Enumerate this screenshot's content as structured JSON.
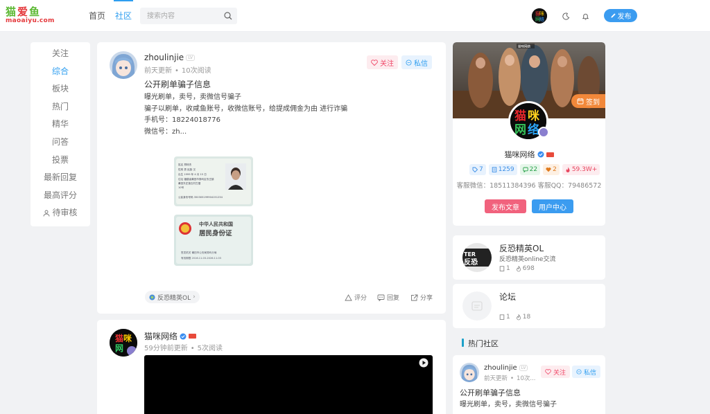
{
  "header": {
    "logo_cn": [
      "猫",
      "爱",
      "鱼"
    ],
    "logo_en": "maoaiyu.com",
    "nav": [
      {
        "label": "首页"
      },
      {
        "label": "社区"
      }
    ],
    "search_placeholder": "搜索内容",
    "publish_label": "发布"
  },
  "sidebar": {
    "items": [
      {
        "label": "关注"
      },
      {
        "label": "综合"
      },
      {
        "label": "板块"
      },
      {
        "label": "热门"
      },
      {
        "label": "精华"
      },
      {
        "label": "问答"
      },
      {
        "label": "投票"
      },
      {
        "label": "最新回复"
      },
      {
        "label": "最高评分"
      },
      {
        "label": "待审核"
      }
    ],
    "active_index": 1
  },
  "post1": {
    "author": "zhoulinjie",
    "time": "前天更新",
    "views": "10次阅读",
    "follow_label": "关注",
    "message_label": "私信",
    "title": "公开刷单骗子信息",
    "lines": [
      "曝光刷单，卖号，卖微信号骗子",
      "骗子以刷单，收咸鱼账号，收微信账号，给提成佣金为由 进行诈骗",
      "手机号：18224018776",
      "微信号：zh..."
    ],
    "id_front": {
      "lines": [
        "姓名 郑林杰",
        "性别 男 民族 汉",
        "出生 1999 年 4 月 15 日",
        "住址 福建省莆田市秀屿区东庄镇",
        "莆田东庄镇五村古厝",
        "10号",
        "公民身份号码 350305199904151234"
      ]
    },
    "id_back": {
      "title1": "中华人民共和国",
      "title2": "居民身份证",
      "issuer": "签发机关  莆田市公安局秀屿分局",
      "valid": "有效期限  2016.11.03-2026.11.03"
    },
    "tag": "反恐精英OL",
    "actions": {
      "rate": "评分",
      "reply": "回复",
      "share": "分享"
    }
  },
  "post2": {
    "author": "猫咪网络",
    "time": "59分钟前更新",
    "views": "5次阅读"
  },
  "profile": {
    "banner_caption": "猫咪网络",
    "signin_label": "签到",
    "avatar_chars": [
      "猫",
      "咪",
      "网",
      "络"
    ],
    "name": "猫咪网络",
    "stats": [
      {
        "icon": "tag-icon",
        "value": "7",
        "color": "#3a8ee6",
        "bg": "#e8f2fd"
      },
      {
        "icon": "doc-icon",
        "value": "1259",
        "color": "#3a8ee6",
        "bg": "#e8f2fd"
      },
      {
        "icon": "comment-icon",
        "value": "22",
        "color": "#2aa24a",
        "bg": "#e6f6ea"
      },
      {
        "icon": "heart-icon",
        "value": "2",
        "color": "#e07a1d",
        "bg": "#fdf0e3"
      },
      {
        "icon": "fire-icon",
        "value": "59.3W+",
        "color": "#e8465f",
        "bg": "#fdecef"
      }
    ],
    "contact": "客服微信：18511384396  客服QQ：79486572",
    "btn_publish": "发布文章",
    "btn_center": "用户中心"
  },
  "forums": [
    {
      "name": "反恐精英OL",
      "desc": "反恐精英online交流",
      "posts": "1",
      "heat": "698"
    },
    {
      "name": "论坛",
      "desc": "",
      "posts": "1",
      "heat": "18"
    }
  ],
  "hot_section": {
    "title": "热门社区",
    "post": {
      "author": "zhoulinjie",
      "time": "前天更新",
      "views": "10次...",
      "follow_label": "关注",
      "message_label": "私信",
      "title": "公开刷单骗子信息",
      "line1": "曝光刷单，卖号，卖微信号骗子"
    }
  },
  "colors": {
    "accent": "#2f9ef0",
    "pink": "#f04a6a",
    "orange": "#f2883a",
    "cyan": "#1da1c9"
  }
}
